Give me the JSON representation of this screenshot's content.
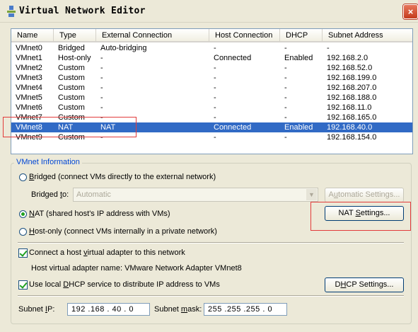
{
  "window": {
    "title": "Virtual Network Editor",
    "close_label": "×"
  },
  "table": {
    "headers": [
      "Name",
      "Type",
      "External Connection",
      "Host Connection",
      "DHCP",
      "Subnet Address"
    ],
    "rows": [
      [
        "VMnet0",
        "Bridged",
        "Auto-bridging",
        "-",
        "-",
        "-"
      ],
      [
        "VMnet1",
        "Host-only",
        "-",
        "Connected",
        "Enabled",
        "192.168.2.0"
      ],
      [
        "VMnet2",
        "Custom",
        "-",
        "-",
        "-",
        "192.168.52.0"
      ],
      [
        "VMnet3",
        "Custom",
        "-",
        "-",
        "-",
        "192.168.199.0"
      ],
      [
        "VMnet4",
        "Custom",
        "-",
        "-",
        "-",
        "192.168.207.0"
      ],
      [
        "VMnet5",
        "Custom",
        "-",
        "-",
        "-",
        "192.168.188.0"
      ],
      [
        "VMnet6",
        "Custom",
        "-",
        "-",
        "-",
        "192.168.11.0"
      ],
      [
        "VMnet7",
        "Custom",
        "-",
        "-",
        "-",
        "192.168.165.0"
      ],
      [
        "VMnet8",
        "NAT",
        "NAT",
        "Connected",
        "Enabled",
        "192.168.40.0"
      ],
      [
        "VMnet9",
        "Custom",
        "-",
        "-",
        "-",
        "192.168.154.0"
      ]
    ],
    "selected_index": 8
  },
  "info": {
    "legend": "VMnet Information",
    "bridged_radio": {
      "key": "B",
      "rest": "ridged (connect VMs directly to the external network)"
    },
    "bridged_to": {
      "pre": "Bridged ",
      "key": "t",
      "rest": "o:",
      "value": "Automatic"
    },
    "auto_settings": {
      "pre": "A",
      "key": "u",
      "rest": "tomatic Settings..."
    },
    "nat_radio": {
      "key": "N",
      "rest": "AT (shared host's IP address with VMs)"
    },
    "nat_settings": {
      "pre": "NAT ",
      "key": "S",
      "rest": "ettings..."
    },
    "hostonly_radio": {
      "key": "H",
      "rest": "ost-only (connect VMs internally in a private network)"
    },
    "connect_adapter": {
      "pre": "Connect a host ",
      "key": "v",
      "rest": "irtual adapter to this network"
    },
    "adapter_name": "Host virtual adapter name: VMware Network Adapter VMnet8",
    "use_dhcp": {
      "pre": "Use local ",
      "key": "D",
      "rest": "HCP service to distribute IP address to VMs"
    },
    "dhcp_settings": {
      "pre": "D",
      "key": "H",
      "rest": "CP Settings..."
    },
    "subnet_ip": {
      "pre": "Subnet ",
      "key": "I",
      "rest": "P:",
      "value": "192 .168 . 40  .  0"
    },
    "subnet_mask": {
      "pre": "Subnet ",
      "key": "m",
      "rest": "ask:",
      "value": "255 .255 .255 .  0"
    },
    "selected_mode": "nat",
    "connect_adapter_checked": true,
    "use_dhcp_checked": true
  },
  "colors": {
    "selection": "#316ac5",
    "highlight_box": "#e23b3b",
    "group_legend": "#0046d5"
  }
}
